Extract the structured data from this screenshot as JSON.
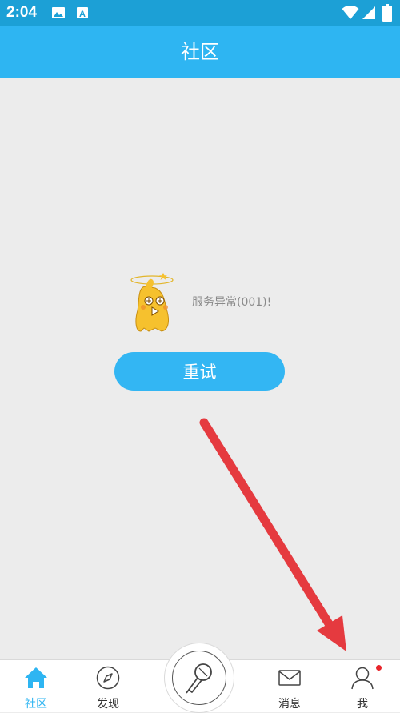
{
  "status_bar": {
    "time": "2:04",
    "icons": [
      "image-icon",
      "a-icon",
      "wifi-icon",
      "signal-icon",
      "battery-icon"
    ]
  },
  "app_bar": {
    "title": "社区"
  },
  "error": {
    "message": "服务异常(001)!",
    "retry_label": "重试"
  },
  "bottom_nav": {
    "items": [
      {
        "label": "社区",
        "icon": "home-icon",
        "active": true
      },
      {
        "label": "发现",
        "icon": "compass-icon",
        "active": false
      },
      {
        "label": "消息",
        "icon": "mail-icon",
        "active": false
      },
      {
        "label": "我",
        "icon": "user-icon",
        "active": false
      }
    ],
    "center_icon": "microphone-icon"
  },
  "colors": {
    "status_bar": "#1ca0d6",
    "app_bar": "#2eb5f2",
    "retry_button": "#33b6f3",
    "background": "#ececec",
    "arrow": "#e53a3f",
    "badge": "#e8252b",
    "active_nav": "#2eb5f2"
  }
}
